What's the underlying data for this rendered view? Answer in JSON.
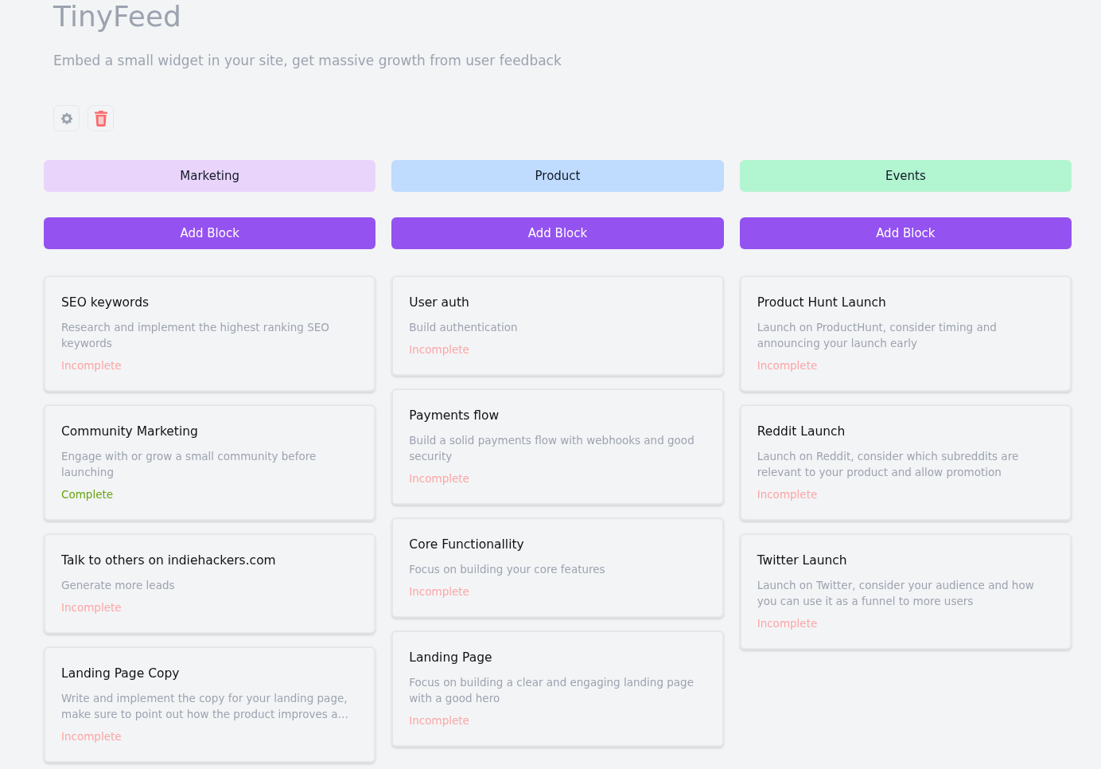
{
  "header": {
    "title": "TinyFeed",
    "subtitle": "Embed a small widget in your site, get massive growth from user feedback"
  },
  "columns": [
    {
      "name": "Marketing",
      "color": "#e9d5fb",
      "button": "Add Block",
      "cards": [
        {
          "title": "SEO keywords",
          "description": "Research and implement the highest ranking SEO keywords",
          "status": "Incomplete",
          "complete": false
        },
        {
          "title": "Community Marketing",
          "description": "Engage with or grow a small community before launching",
          "status": "Complete",
          "complete": true
        },
        {
          "title": "Talk to others on indiehackers.com",
          "description": "Generate more leads",
          "status": "Incomplete",
          "complete": false
        },
        {
          "title": "Landing Page Copy",
          "description": "Write and implement the copy for your landing page, make sure to point out how the product improves a…",
          "status": "Incomplete",
          "complete": false
        }
      ]
    },
    {
      "name": "Product",
      "color": "#bfdbfe",
      "button": "Add Block",
      "cards": [
        {
          "title": "User auth",
          "description": "Build authentication",
          "status": "Incomplete",
          "complete": false
        },
        {
          "title": "Payments flow",
          "description": "Build a solid payments flow with webhooks and good security",
          "status": "Incomplete",
          "complete": false
        },
        {
          "title": "Core Functionallity",
          "description": "Focus on building your core features",
          "status": "Incomplete",
          "complete": false
        },
        {
          "title": "Landing Page",
          "description": "Focus on building a clear and engaging landing page with a good hero",
          "status": "Incomplete",
          "complete": false
        }
      ]
    },
    {
      "name": "Events",
      "color": "#b2f5d1",
      "button": "Add Block",
      "cards": [
        {
          "title": "Product Hunt Launch",
          "description": "Launch on ProductHunt, consider timing and announcing your launch early",
          "status": "Incomplete",
          "complete": false
        },
        {
          "title": "Reddit Launch",
          "description": "Launch on Reddit, consider which subreddits are relevant to your product and allow promotion",
          "status": "Incomplete",
          "complete": false
        },
        {
          "title": "Twitter Launch",
          "description": "Launch on Twitter, consider your audience and how you can use it as a funnel to more users",
          "status": "Incomplete",
          "complete": false
        }
      ]
    }
  ]
}
